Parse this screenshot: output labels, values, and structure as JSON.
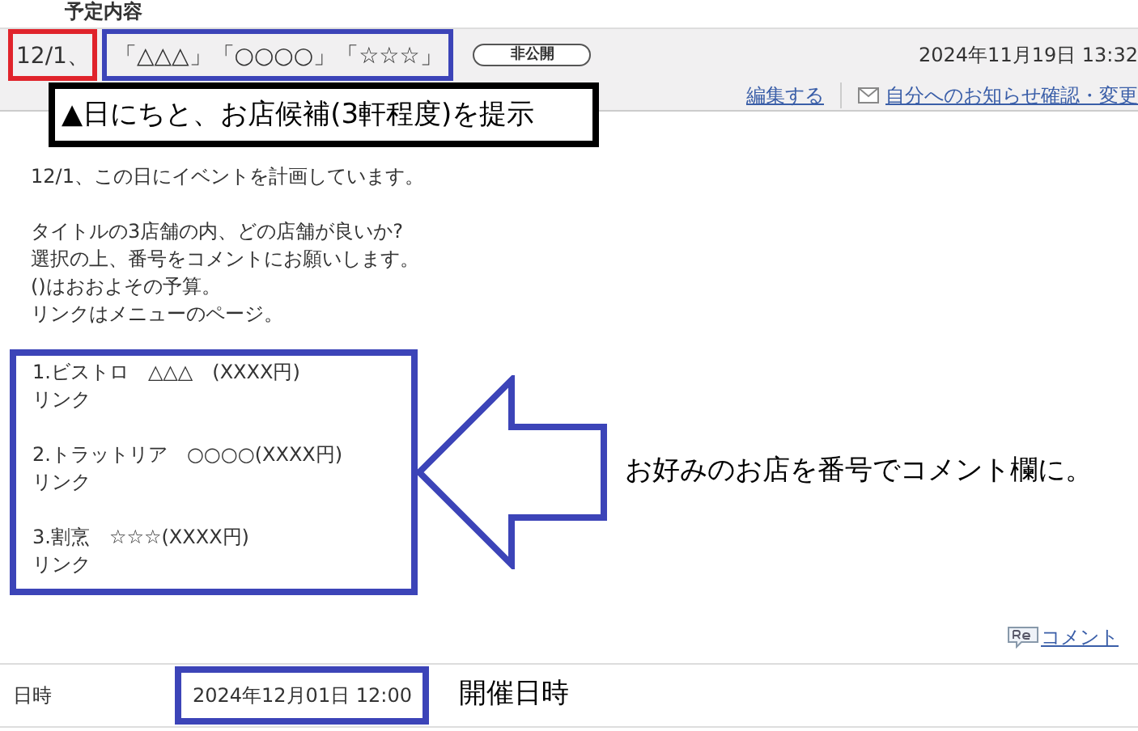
{
  "heading": "予定内容",
  "event": {
    "title_date": "12/1、",
    "title_shops": "「△△△」「○○○○」「☆☆☆」",
    "visibility": "非公開",
    "posted": "2024年11月19日 13:32",
    "links": [
      {
        "kind": "edit",
        "label": "編集する"
      },
      {
        "kind": "mail",
        "label": "自分へのお知らせ確認・変更"
      }
    ]
  },
  "callout": "▲日にちと、お店候補(3軒程度)を提示",
  "body": [
    [
      "12/1、この日にイベントを計画しています。"
    ],
    [
      "タイトルの3店舗の内、どの店舗が良いか?",
      "選択の上、番号をコメントにお願いします。",
      "()はおおよその予算。",
      "リンクはメニューのページ。"
    ]
  ],
  "shops": [
    {
      "name": "1.ビストロ　△△△　(XXXX円)",
      "link": "リンク"
    },
    {
      "name": "2.トラットリア　○○○○(XXXX円)",
      "link": "リンク"
    },
    {
      "name": "3.割烹　☆☆☆(XXXX円)",
      "link": "リンク"
    }
  ],
  "arrow_note": "お好みのお店を番号でコメント欄に。",
  "comment_link": "コメント",
  "details": [
    {
      "label": "日時",
      "value": "2024年12月01日 12:00",
      "note": "開催日時"
    }
  ]
}
